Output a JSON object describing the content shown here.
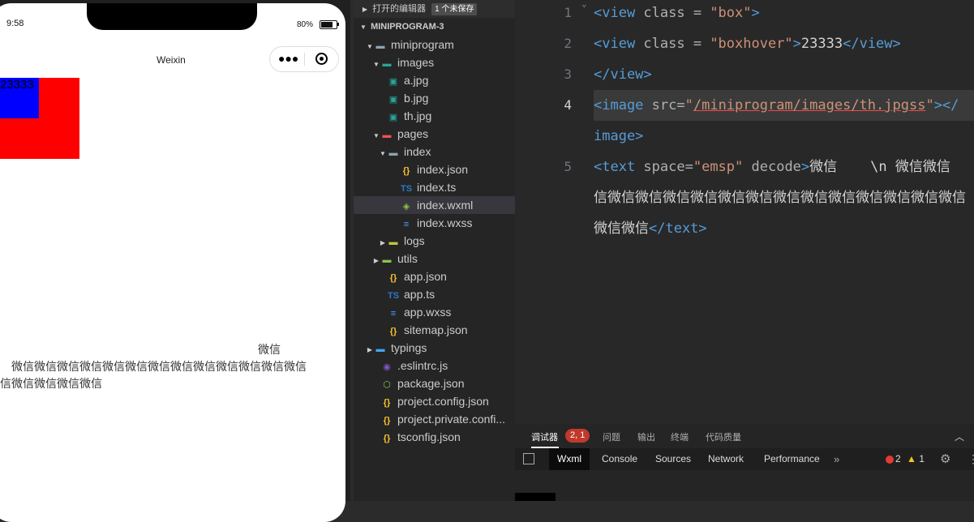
{
  "simulator": {
    "time": "9:58",
    "battery": "80%",
    "nav_title": "Weixin",
    "boxhover_text": "23333",
    "text_lines": [
      "微信",
      "微信微信微信微信微信微信微信微信微信微信微信微信微信",
      "信微信微信微信微信"
    ]
  },
  "explorer": {
    "open_editors_label": "打开的编辑器",
    "unsaved_badge": "1 个未保存",
    "project": "MINIPROGRAM-3",
    "items": [
      {
        "label": "miniprogram",
        "icon": "folder-icon"
      },
      {
        "label": "images",
        "icon": "image-folder-icon"
      },
      {
        "label": "a.jpg",
        "icon": "image-file-icon"
      },
      {
        "label": "b.jpg",
        "icon": "image-file-icon"
      },
      {
        "label": "th.jpg",
        "icon": "image-file-icon"
      },
      {
        "label": "pages",
        "icon": "pages-folder-icon"
      },
      {
        "label": "index",
        "icon": "folder-icon"
      },
      {
        "label": "index.json",
        "icon": "json-icon"
      },
      {
        "label": "index.ts",
        "icon": "ts-icon"
      },
      {
        "label": "index.wxml",
        "icon": "wxml-icon"
      },
      {
        "label": "index.wxss",
        "icon": "wxss-icon"
      },
      {
        "label": "logs",
        "icon": "logs-folder-icon"
      },
      {
        "label": "utils",
        "icon": "utils-folder-icon"
      },
      {
        "label": "app.json",
        "icon": "json-icon"
      },
      {
        "label": "app.ts",
        "icon": "ts-icon"
      },
      {
        "label": "app.wxss",
        "icon": "wxss-icon"
      },
      {
        "label": "sitemap.json",
        "icon": "json-icon"
      },
      {
        "label": "typings",
        "icon": "typings-folder-icon"
      },
      {
        "label": ".eslintrc.js",
        "icon": "eslint-icon"
      },
      {
        "label": "package.json",
        "icon": "package-icon"
      },
      {
        "label": "project.config.json",
        "icon": "json-icon"
      },
      {
        "label": "project.private.confi...",
        "icon": "json-icon"
      },
      {
        "label": "tsconfig.json",
        "icon": "json-icon"
      }
    ]
  },
  "editor": {
    "line_numbers": [
      "1",
      "2",
      "3",
      "4",
      "5"
    ],
    "line1": {
      "tag": "<view",
      "attr": " class = ",
      "val": "\"box\"",
      "close": ">"
    },
    "line2": {
      "tag": "<view",
      "attr": " class = ",
      "val": "\"boxhover\"",
      "close": ">",
      "text": "23333",
      "end": "</view>"
    },
    "line3": {
      "end": "</view>"
    },
    "line4": {
      "tag": "<image",
      "attr": " src=",
      "q1": "\"",
      "path": "/miniprogram/images/th.jpgss",
      "q2": "\"",
      "close": "></",
      "wrap": "image>"
    },
    "line5": {
      "tag": "<text",
      "attr1": " space=",
      "val1": "\"emsp\"",
      "attr2": " decode",
      "close": ">",
      "text1": "微信    \\n 微信微信",
      "wrap1": "信微信微信微信微信微信微信微信微信微信微信微信微信微信",
      "wrap2": "微信微信",
      "end": "</text>"
    }
  },
  "panel": {
    "tabs": [
      "调试器",
      "问题",
      "输出",
      "终端",
      "代码质量"
    ],
    "debugger_badge": "2, 1",
    "devtools_tabs": [
      "Wxml",
      "Console",
      "Sources",
      "Network",
      "Performance"
    ],
    "more": "»",
    "errors": "2",
    "warnings": "1"
  }
}
